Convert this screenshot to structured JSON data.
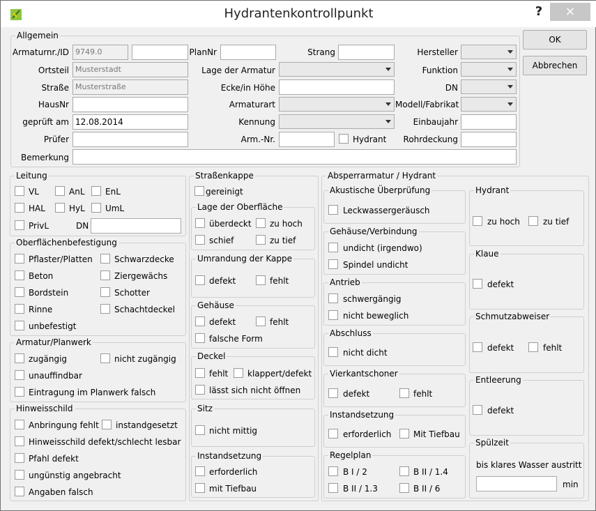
{
  "window": {
    "title": "Hydrantenkontrollpunkt",
    "help": "?",
    "close": "×"
  },
  "buttons": {
    "ok": "OK",
    "cancel": "Abbrechen"
  },
  "allgemein": {
    "legend": "Allgemein",
    "armaturnr_label": "Armaturnr./ID",
    "armaturnr_value": "9749.0",
    "armaturnr_value2": "",
    "plannr_label": "PlanNr",
    "plannr_value": "",
    "strang_label": "Strang",
    "strang_value": "",
    "hersteller_label": "Hersteller",
    "ortsteil_label": "Ortsteil",
    "ortsteil_value": "Musterstadt",
    "lage_label": "Lage der Armatur",
    "funktion_label": "Funktion",
    "strasse_label": "Straße",
    "strasse_value": "Musterstraße",
    "ecke_label": "Ecke/in Höhe",
    "ecke_value": "",
    "dn_label": "DN",
    "hausnr_label": "HausNr",
    "hausnr_value": "",
    "armaturart_label": "Armaturart",
    "modell_label": "Modell/Fabrikat",
    "geprueft_label": "geprüft am",
    "geprueft_value": "12.08.2014",
    "kennung_label": "Kennung",
    "einbaujahr_label": "Einbaujahr",
    "einbaujahr_value": "",
    "pruefer_label": "Prüfer",
    "pruefer_value": "",
    "armnr_label": "Arm.-Nr.",
    "armnr_value": "",
    "hydrant_label": "Hydrant",
    "rohrdeckung_label": "Rohrdeckung",
    "rohrdeckung_value": "",
    "bemerkung_label": "Bemerkung",
    "bemerkung_value": ""
  },
  "leitung": {
    "legend": "Leitung",
    "vl": "VL",
    "anl": "AnL",
    "enl": "EnL",
    "hal": "HAL",
    "hyl": "HyL",
    "uml": "UmL",
    "privl": "PrivL",
    "dn": "DN",
    "dn_value": ""
  },
  "oberflaeche": {
    "legend": "Oberflächenbefestigung",
    "pflaster": "Pflaster/Platten",
    "schwarzdecke": "Schwarzdecke",
    "beton": "Beton",
    "ziergewaechs": "Ziergewächs",
    "bordstein": "Bordstein",
    "schotter": "Schotter",
    "rinne": "Rinne",
    "schachtdeckel": "Schachtdeckel",
    "unbefestigt": "unbefestigt"
  },
  "armatur_plan": {
    "legend": "Armatur/Planwerk",
    "zugaengig": "zugängig",
    "nicht_zugaengig": "nicht zugängig",
    "unauffindbar": "unauffindbar",
    "eintragung": "Eintragung im Planwerk falsch"
  },
  "hinweis": {
    "legend": "Hinweisschild",
    "anbringung": "Anbringung fehlt",
    "instandgesetzt": "instandgesetzt",
    "defekt": "Hinweisschild defekt/schlecht lesbar",
    "pfahl": "Pfahl defekt",
    "unguenstig": "ungünstig angebracht",
    "angaben": "Angaben falsch"
  },
  "strassenkappe": {
    "legend": "Straßenkappe",
    "gereinigt": "gereinigt",
    "lage_legend": "Lage der Oberfläche",
    "ueberdeckt": "überdeckt",
    "zu_hoch": "zu hoch",
    "schief": "schief",
    "zu_tief": "zu tief",
    "umrandung_legend": "Umrandung der Kappe",
    "defekt": "defekt",
    "fehlt": "fehlt",
    "gehaeuse_legend": "Gehäuse",
    "falsche_form": "falsche Form",
    "deckel_legend": "Deckel",
    "klappert": "klappert/defekt",
    "nicht_oeffnen": "lässt sich nicht öffnen",
    "sitz_legend": "Sitz",
    "nicht_mittig": "nicht mittig",
    "instand_legend": "Instandsetzung",
    "erforderlich": "erforderlich",
    "mit_tiefbau": "mit Tiefbau"
  },
  "absperr": {
    "legend": "Absperrarmatur / Hydrant",
    "akustik_legend": "Akustische Überprüfung",
    "leckwasser": "Leckwassergeräusch",
    "gehaeuse_legend": "Gehäuse/Verbindung",
    "undicht": "undicht (irgendwo)",
    "spindel": "Spindel undicht",
    "antrieb_legend": "Antrieb",
    "schwergaengig": "schwergängig",
    "nicht_beweglich": "nicht beweglich",
    "abschluss_legend": "Abschluss",
    "nicht_dicht": "nicht dicht",
    "vierkant_legend": "Vierkantschoner",
    "defekt": "defekt",
    "fehlt": "fehlt",
    "instand_legend": "Instandsetzung",
    "erforderlich": "erforderlich",
    "mit_tiefbau": "Mit Tiefbau",
    "regelplan_legend": "Regelplan",
    "b1_2": "B I / 2",
    "b2_14": "B II / 1.4",
    "b2_13": "B II / 1.3",
    "b2_6": "B II / 6"
  },
  "hydrant_box": {
    "legend": "Hydrant",
    "zu_hoch": "zu hoch",
    "zu_tief": "zu tief"
  },
  "klaue": {
    "legend": "Klaue",
    "defekt": "defekt"
  },
  "schmutz": {
    "legend": "Schmutzabweiser",
    "defekt": "defekt",
    "fehlt": "fehlt"
  },
  "entleerung": {
    "legend": "Entleerung",
    "defekt": "defekt"
  },
  "spuelzeit": {
    "legend": "Spülzeit",
    "text": "bis klares Wasser austritt",
    "value": "",
    "unit": "min"
  }
}
